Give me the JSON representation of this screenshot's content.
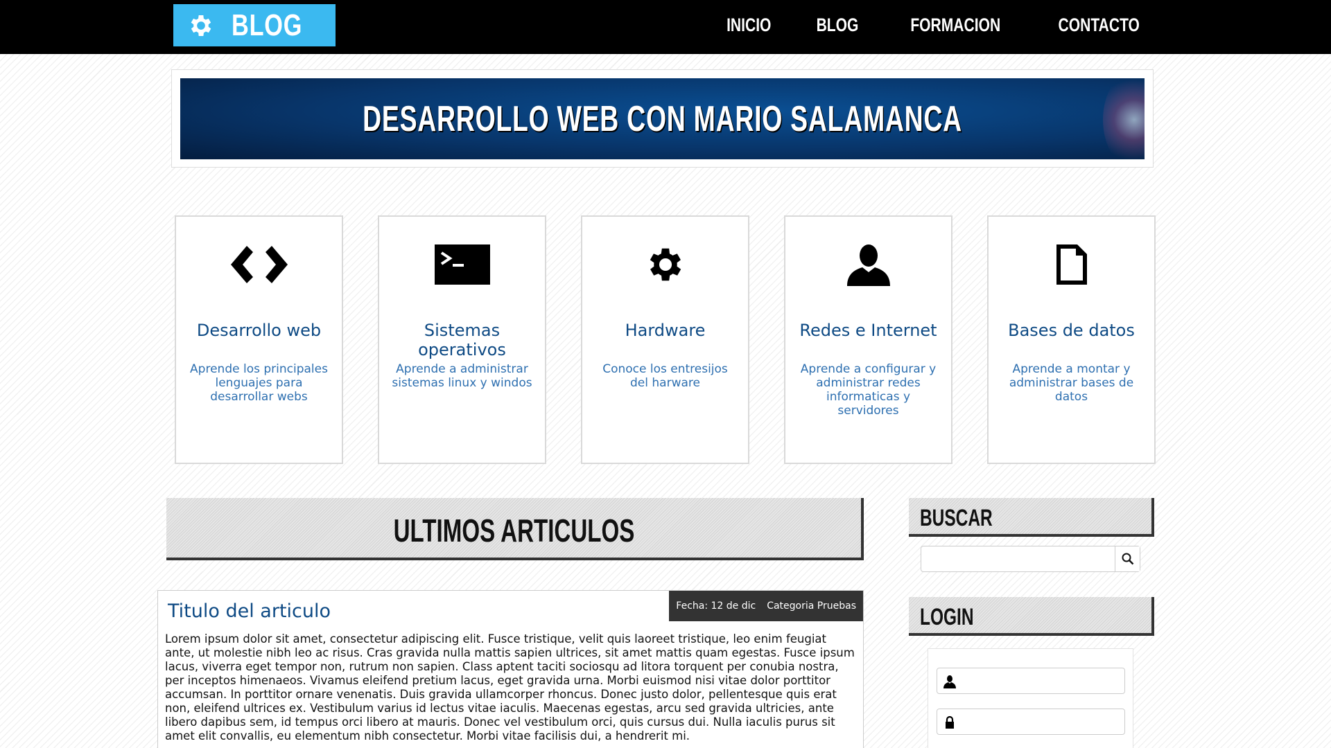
{
  "header": {
    "logo_text": "BLOG",
    "nav": [
      "INICIO",
      "BLOG",
      "FORMACION",
      "CONTACTO"
    ]
  },
  "banner": {
    "title": "DESARROLLO WEB CON MARIO SALAMANCA"
  },
  "cards": [
    {
      "icon": "code-icon",
      "title": "Desarrollo web",
      "desc": "Aprende los principales lenguajes para desarrollar webs"
    },
    {
      "icon": "terminal-icon",
      "title": "Sistemas operativos",
      "desc": "Aprende a administrar sistemas linux y windos"
    },
    {
      "icon": "gear-icon",
      "title": "Hardware",
      "desc": "Conoce los entresijos del harware"
    },
    {
      "icon": "user-icon",
      "title": "Redes e Internet",
      "desc": "Aprende a configurar y administrar redes informaticas y servidores"
    },
    {
      "icon": "file-icon",
      "title": "Bases de datos",
      "desc": "Aprende a montar y administrar bases de datos"
    }
  ],
  "latest": {
    "heading": "ULTIMOS ARTICULOS"
  },
  "article": {
    "title": "Titulo del articulo",
    "date": "Fecha: 12 de dic",
    "category": "Categoria Pruebas",
    "body": "Lorem ipsum dolor sit amet, consectetur adipiscing elit. Fusce tristique, velit quis laoreet tristique, leo enim feugiat ante, ut molestie nibh leo ac risus. Cras gravida nulla mattis sapien ultrices, sit amet mattis quam egestas. Fusce ipsum lacus, viverra eget tempor non, rutrum non sapien. Class aptent taciti sociosqu ad litora torquent per conubia nostra, per inceptos himenaeos. Vivamus eleifend pretium lacus, eget gravida urna. Morbi euismod nisi vitae dolor porttitor accumsan. In porttitor ornare venenatis. Duis gravida ullamcorper rhoncus. Donec justo dolor, pellentesque quis erat non, eleifend ultrices ex. Vestibulum varius id lectus vitae iaculis. Maecenas egestas, arcu sed gravida ultricies, ante libero dapibus sem, id tempus orci libero at mauris. Donec vel vestibulum orci, quis cursus dui. Nulla iaculis purus sit amet elit convallis, eu elementum nibh consectetur. Morbi vitae facilisis dui, a hendrerit mi."
  },
  "sidebar": {
    "search_heading": "BUSCAR",
    "search_value": "",
    "login_heading": "LOGIN",
    "username_value": "",
    "password_value": ""
  },
  "colors": {
    "topbar": "#000000",
    "logo_bg": "#3bb9f0",
    "card_title": "#0e4a84",
    "card_desc": "#2d6fb0"
  }
}
